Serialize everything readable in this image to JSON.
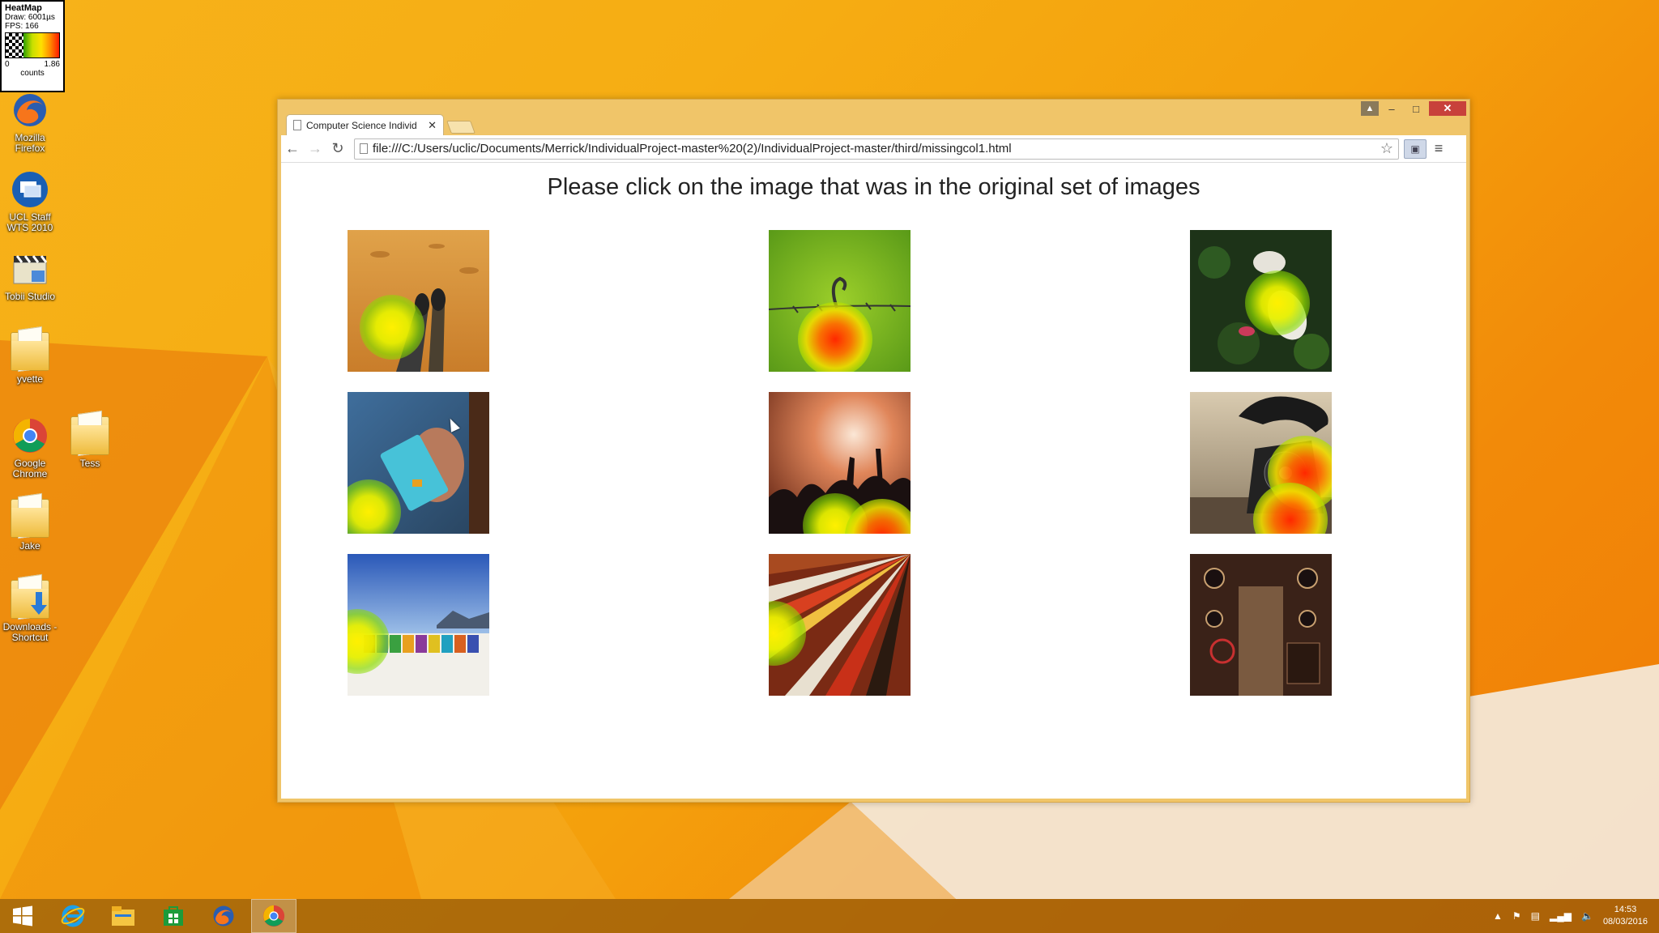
{
  "heatmap_widget": {
    "title": "HeatMap",
    "draw": "Draw: 6001µs",
    "fps": "FPS: 166",
    "range_min": "0",
    "range_max": "1.86",
    "units": "counts"
  },
  "desktop": {
    "icons": [
      {
        "label": "Mozilla Firefox",
        "icon": "firefox-icon"
      },
      {
        "label": "UCL Staff WTS 2010",
        "icon": "remote-desktop-icon"
      },
      {
        "label": "Tobii Studio",
        "icon": "clapperboard-icon"
      },
      {
        "label": "yvette",
        "icon": "folder-icon"
      },
      {
        "label": "Google Chrome",
        "icon": "chrome-icon"
      },
      {
        "label": "Tess",
        "icon": "folder-icon"
      },
      {
        "label": "Jake",
        "icon": "folder-icon"
      },
      {
        "label": "Downloads - Shortcut",
        "icon": "downloads-folder-icon"
      }
    ]
  },
  "browser": {
    "tab_title": "Computer Science Individ",
    "url": "file:///C:/Users/uclic/Documents/Merrick/IndividualProject-master%20(2)/IndividualProject-master/third/missingcol1.html",
    "window_controls": {
      "minimize": "–",
      "maximize": "□",
      "close": "✕"
    }
  },
  "page": {
    "heading": "Please click on the image that was in the original set of images",
    "images": [
      {
        "subject": "desert-feet"
      },
      {
        "subject": "barbed-wire"
      },
      {
        "subject": "white-flower"
      },
      {
        "subject": "credit-card"
      },
      {
        "subject": "concert-crowd"
      },
      {
        "subject": "rotary-telephone"
      },
      {
        "subject": "beach-huts"
      },
      {
        "subject": "colourful-rug"
      },
      {
        "subject": "machine-room"
      }
    ]
  },
  "taskbar": {
    "apps": [
      "start-icon",
      "internet-explorer-icon",
      "file-explorer-icon",
      "store-icon",
      "firefox-icon",
      "chrome-icon"
    ],
    "active_app": "chrome-icon",
    "time": "14:53",
    "date": "08/03/2016"
  },
  "colors": {
    "wallpaper": "#f6ad13",
    "window_frame": "#f0c569",
    "close_button": "#c8413b",
    "heat_low": "#b8e400",
    "heat_high": "#ff2a00"
  }
}
